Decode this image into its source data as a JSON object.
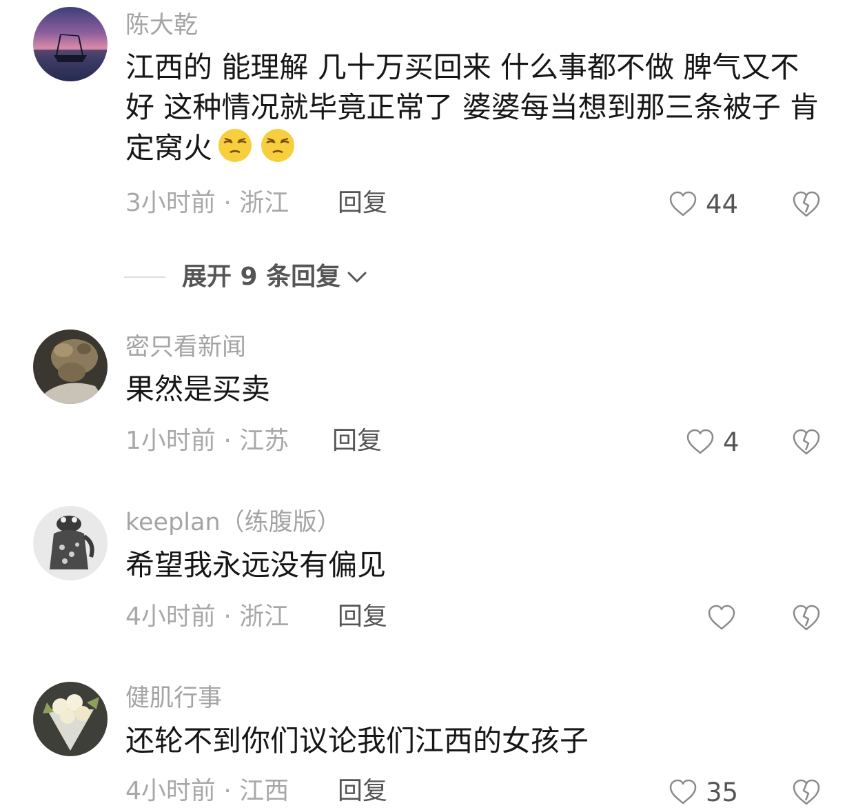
{
  "comments": [
    {
      "username": "陈大乾",
      "text": "江西的 能理解 几十万买回来 什么事都不做 脾气又不好 这种情况就毕竟正常了 婆婆每当想到那三条被子 肯定窝火",
      "emojis": [
        "smirk-emoji",
        "smirk-emoji"
      ],
      "meta": "3小时前 · 浙江",
      "reply_label": "回复",
      "likes": "44",
      "expand_label": "展开 9 条回复",
      "avatar_icon": "sunset-boat-avatar"
    },
    {
      "username": "密只看新闻",
      "text": "果然是买卖",
      "meta": "1小时前 · 江苏",
      "reply_label": "回复",
      "likes": "4",
      "avatar_icon": "puppy-avatar"
    },
    {
      "username": "keeplan（练腹版）",
      "text": "希望我永远没有偏见",
      "meta": "4小时前 · 浙江",
      "reply_label": "回复",
      "likes": "",
      "avatar_icon": "frog-statue-avatar"
    },
    {
      "username": "健肌行事",
      "text": "还轮不到你们议论我们江西的女孩子",
      "meta": "4小时前 · 江西",
      "reply_label": "回复",
      "likes": "35",
      "avatar_icon": "flower-bouquet-avatar"
    }
  ],
  "colors": {
    "username": "#a4a4a4",
    "text": "#161616",
    "meta": "#a8a8a8",
    "action": "#555555"
  }
}
